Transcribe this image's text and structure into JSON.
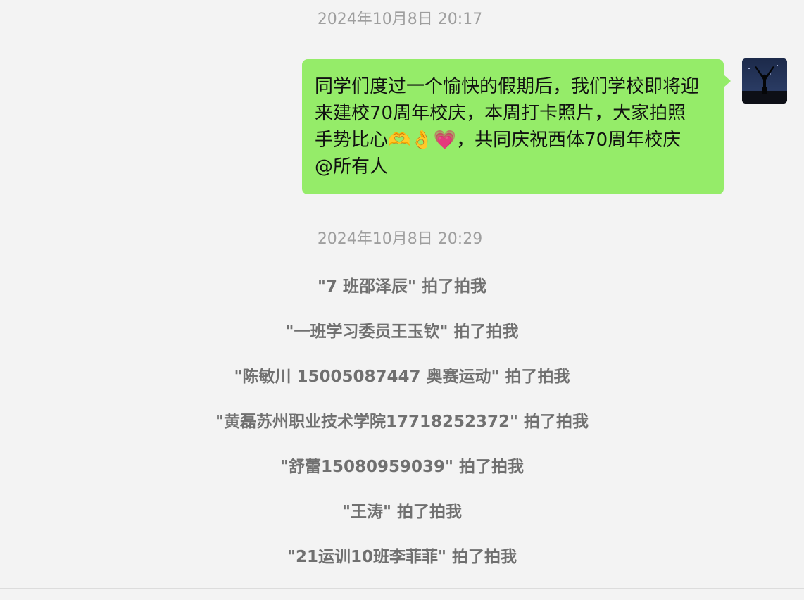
{
  "timestamps": [
    "2024年10月8日 20:17",
    "2024年10月8日 20:29"
  ],
  "message": {
    "text": "同学们度过一个愉快的假期后，我们学校即将迎\n来建校70周年校庆，本周打卡照片，大家拍照\n手势比心🫶👌💗，共同庆祝西体70周年校庆\n@所有人",
    "bubble_color": "#95ec69"
  },
  "avatar": {
    "icon": "avatar-photo"
  },
  "pats": [
    {
      "name": "\"7 班邵泽辰\"",
      "suffix": " 拍了拍我"
    },
    {
      "name": "\"一班学习委员王玉钦\"",
      "suffix": " 拍了拍我"
    },
    {
      "name": "\"陈敏川 15005087447 奥赛运动\"",
      "suffix": " 拍了拍我"
    },
    {
      "name": "\"黄磊苏州职业技术学院17718252372\"",
      "suffix": " 拍了拍我"
    },
    {
      "name": "\"舒蕾15080959039\"",
      "suffix": " 拍了拍我"
    },
    {
      "name": "\"王涛\"",
      "suffix": " 拍了拍我"
    },
    {
      "name": "\"21运训10班李菲菲\"",
      "suffix": " 拍了拍我"
    }
  ]
}
